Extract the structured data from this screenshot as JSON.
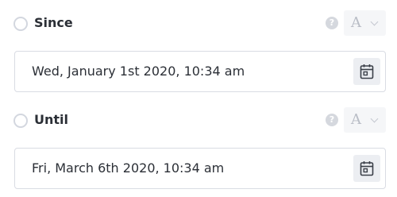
{
  "since": {
    "label": "Since",
    "help_glyph": "?",
    "type_glyph": "A",
    "date_value": "Wed, January 1st 2020, 10:34 am"
  },
  "until": {
    "label": "Until",
    "help_glyph": "?",
    "type_glyph": "A",
    "date_value": "Fri, March 6th 2020, 10:34 am"
  },
  "icons": {
    "radio": "radio-icon",
    "help": "help-icon",
    "chevron": "chevron-down-icon",
    "calendar": "calendar-icon"
  },
  "colors": {
    "text": "#2b2f36",
    "border": "#d9dce3",
    "muted": "#b9bdc6",
    "button_bg": "#eceef2"
  }
}
